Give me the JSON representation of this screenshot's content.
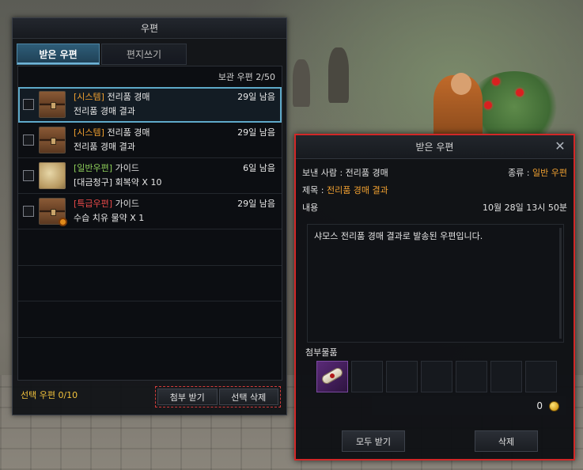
{
  "mail_window": {
    "title": "우편",
    "tabs": [
      {
        "label": "받은 우편",
        "active": true
      },
      {
        "label": "편지쓰기",
        "active": false
      }
    ],
    "storage": "보관 우편 2/50",
    "items": [
      {
        "tag": "[시스템]",
        "tag_color": "#f0a030",
        "sender": "전리품 경매",
        "days": "29일 남음",
        "subject": "전리품 경매 결과",
        "icon": "chest-icon",
        "selected": true
      },
      {
        "tag": "[시스템]",
        "tag_color": "#f0a030",
        "sender": "전리품 경매",
        "days": "29일 남음",
        "subject": "전리품 경매 결과",
        "icon": "chest-icon",
        "selected": false
      },
      {
        "tag": "[일반우편]",
        "tag_color": "#8fd05a",
        "sender": "가이드",
        "days": "6일 남음",
        "subject": "[대금청구] 회복약 X 10",
        "icon": "scroll-paper-icon",
        "selected": false
      },
      {
        "tag": "[특급우편]",
        "tag_color": "#e94a4a",
        "sender": "가이드",
        "days": "29일 남음",
        "subject": "수습 치유 물약 X 1",
        "icon": "chest-icon",
        "selected": false
      }
    ],
    "selected_count": "선택 우편 0/10",
    "buttons": {
      "claim_attachments": "첨부 받기",
      "delete_selected": "선택 삭제"
    }
  },
  "received_window": {
    "title": "받은 우편",
    "sender_label": "보낸 사람 : 전리품 경매",
    "type_label": "종류 :",
    "type_value": "일반 우편",
    "subject_label": "제목 :",
    "subject_value": "전리품 경매 결과",
    "content_label": "내용",
    "date": "10월 28일 13시 50분",
    "body": "샤모스 전리품 경매 결과로 발송된 우편입니다.",
    "attachments_label": "첨부물품",
    "gold": "0",
    "buttons": {
      "receive_all": "모두 받기",
      "delete": "삭제"
    }
  },
  "colors": {
    "highlight_border": "#d22828",
    "accent_orange": "#f0a030",
    "selected_row_outline": "#5ea9c9",
    "footer_text": "#f2c23c"
  }
}
